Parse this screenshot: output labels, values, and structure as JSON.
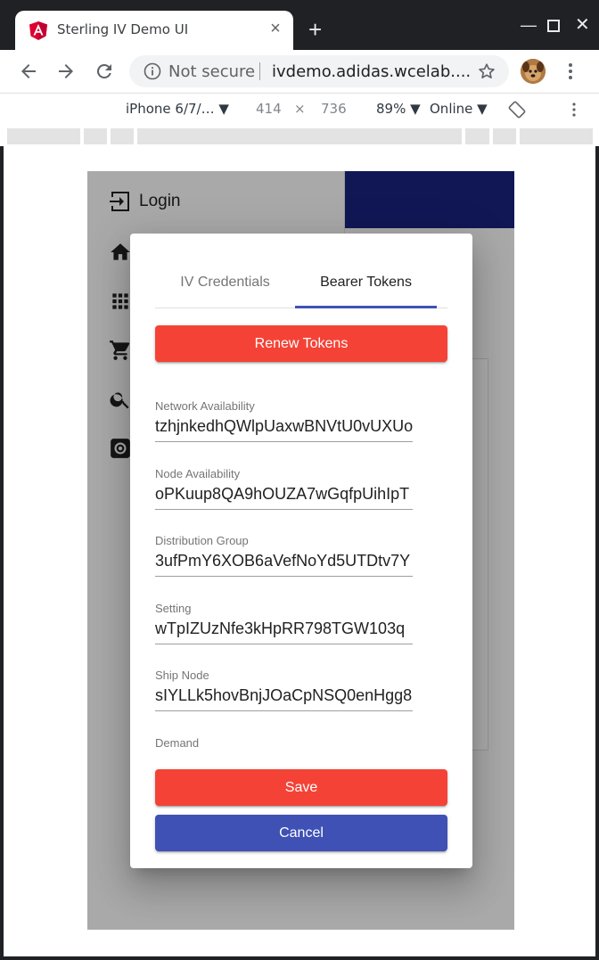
{
  "browser": {
    "tab_title": "Sterling IV Demo UI",
    "not_secure": "Not secure",
    "url": "ivdemo.adidas.wcelab....",
    "devtools": {
      "device": "iPhone 6/7/… ▼",
      "width": "414",
      "times": "×",
      "height": "736",
      "zoom": "89% ▼",
      "throttle": "Online ▼"
    }
  },
  "side_menu": {
    "login_label": "Login"
  },
  "dialog": {
    "tabs": [
      {
        "label": "IV Credentials",
        "active": false
      },
      {
        "label": "Bearer Tokens",
        "active": true
      }
    ],
    "renew_button": "Renew Tokens",
    "fields": [
      {
        "label": "Network Availability",
        "value": "tzhjnkedhQWlpUaxwBNVtU0vUXUo"
      },
      {
        "label": "Node Availability",
        "value": "oPKuup8QA9hOUZA7wGqfpUihIpT"
      },
      {
        "label": "Distribution Group",
        "value": "3ufPmY6XOB6aVefNoYd5UTDtv7Y"
      },
      {
        "label": "Setting",
        "value": "wTpIZUzNfe3kHpRR798TGW103q"
      },
      {
        "label": "Ship Node",
        "value": "sIYLLk5hovBnjJOaCpNSQ0enHgg8"
      },
      {
        "label": "Demand",
        "value": ""
      }
    ],
    "save_button": "Save",
    "cancel_button": "Cancel"
  },
  "colors": {
    "primary": "#3f51b5",
    "warn": "#f44336",
    "header": "#1a237e"
  }
}
